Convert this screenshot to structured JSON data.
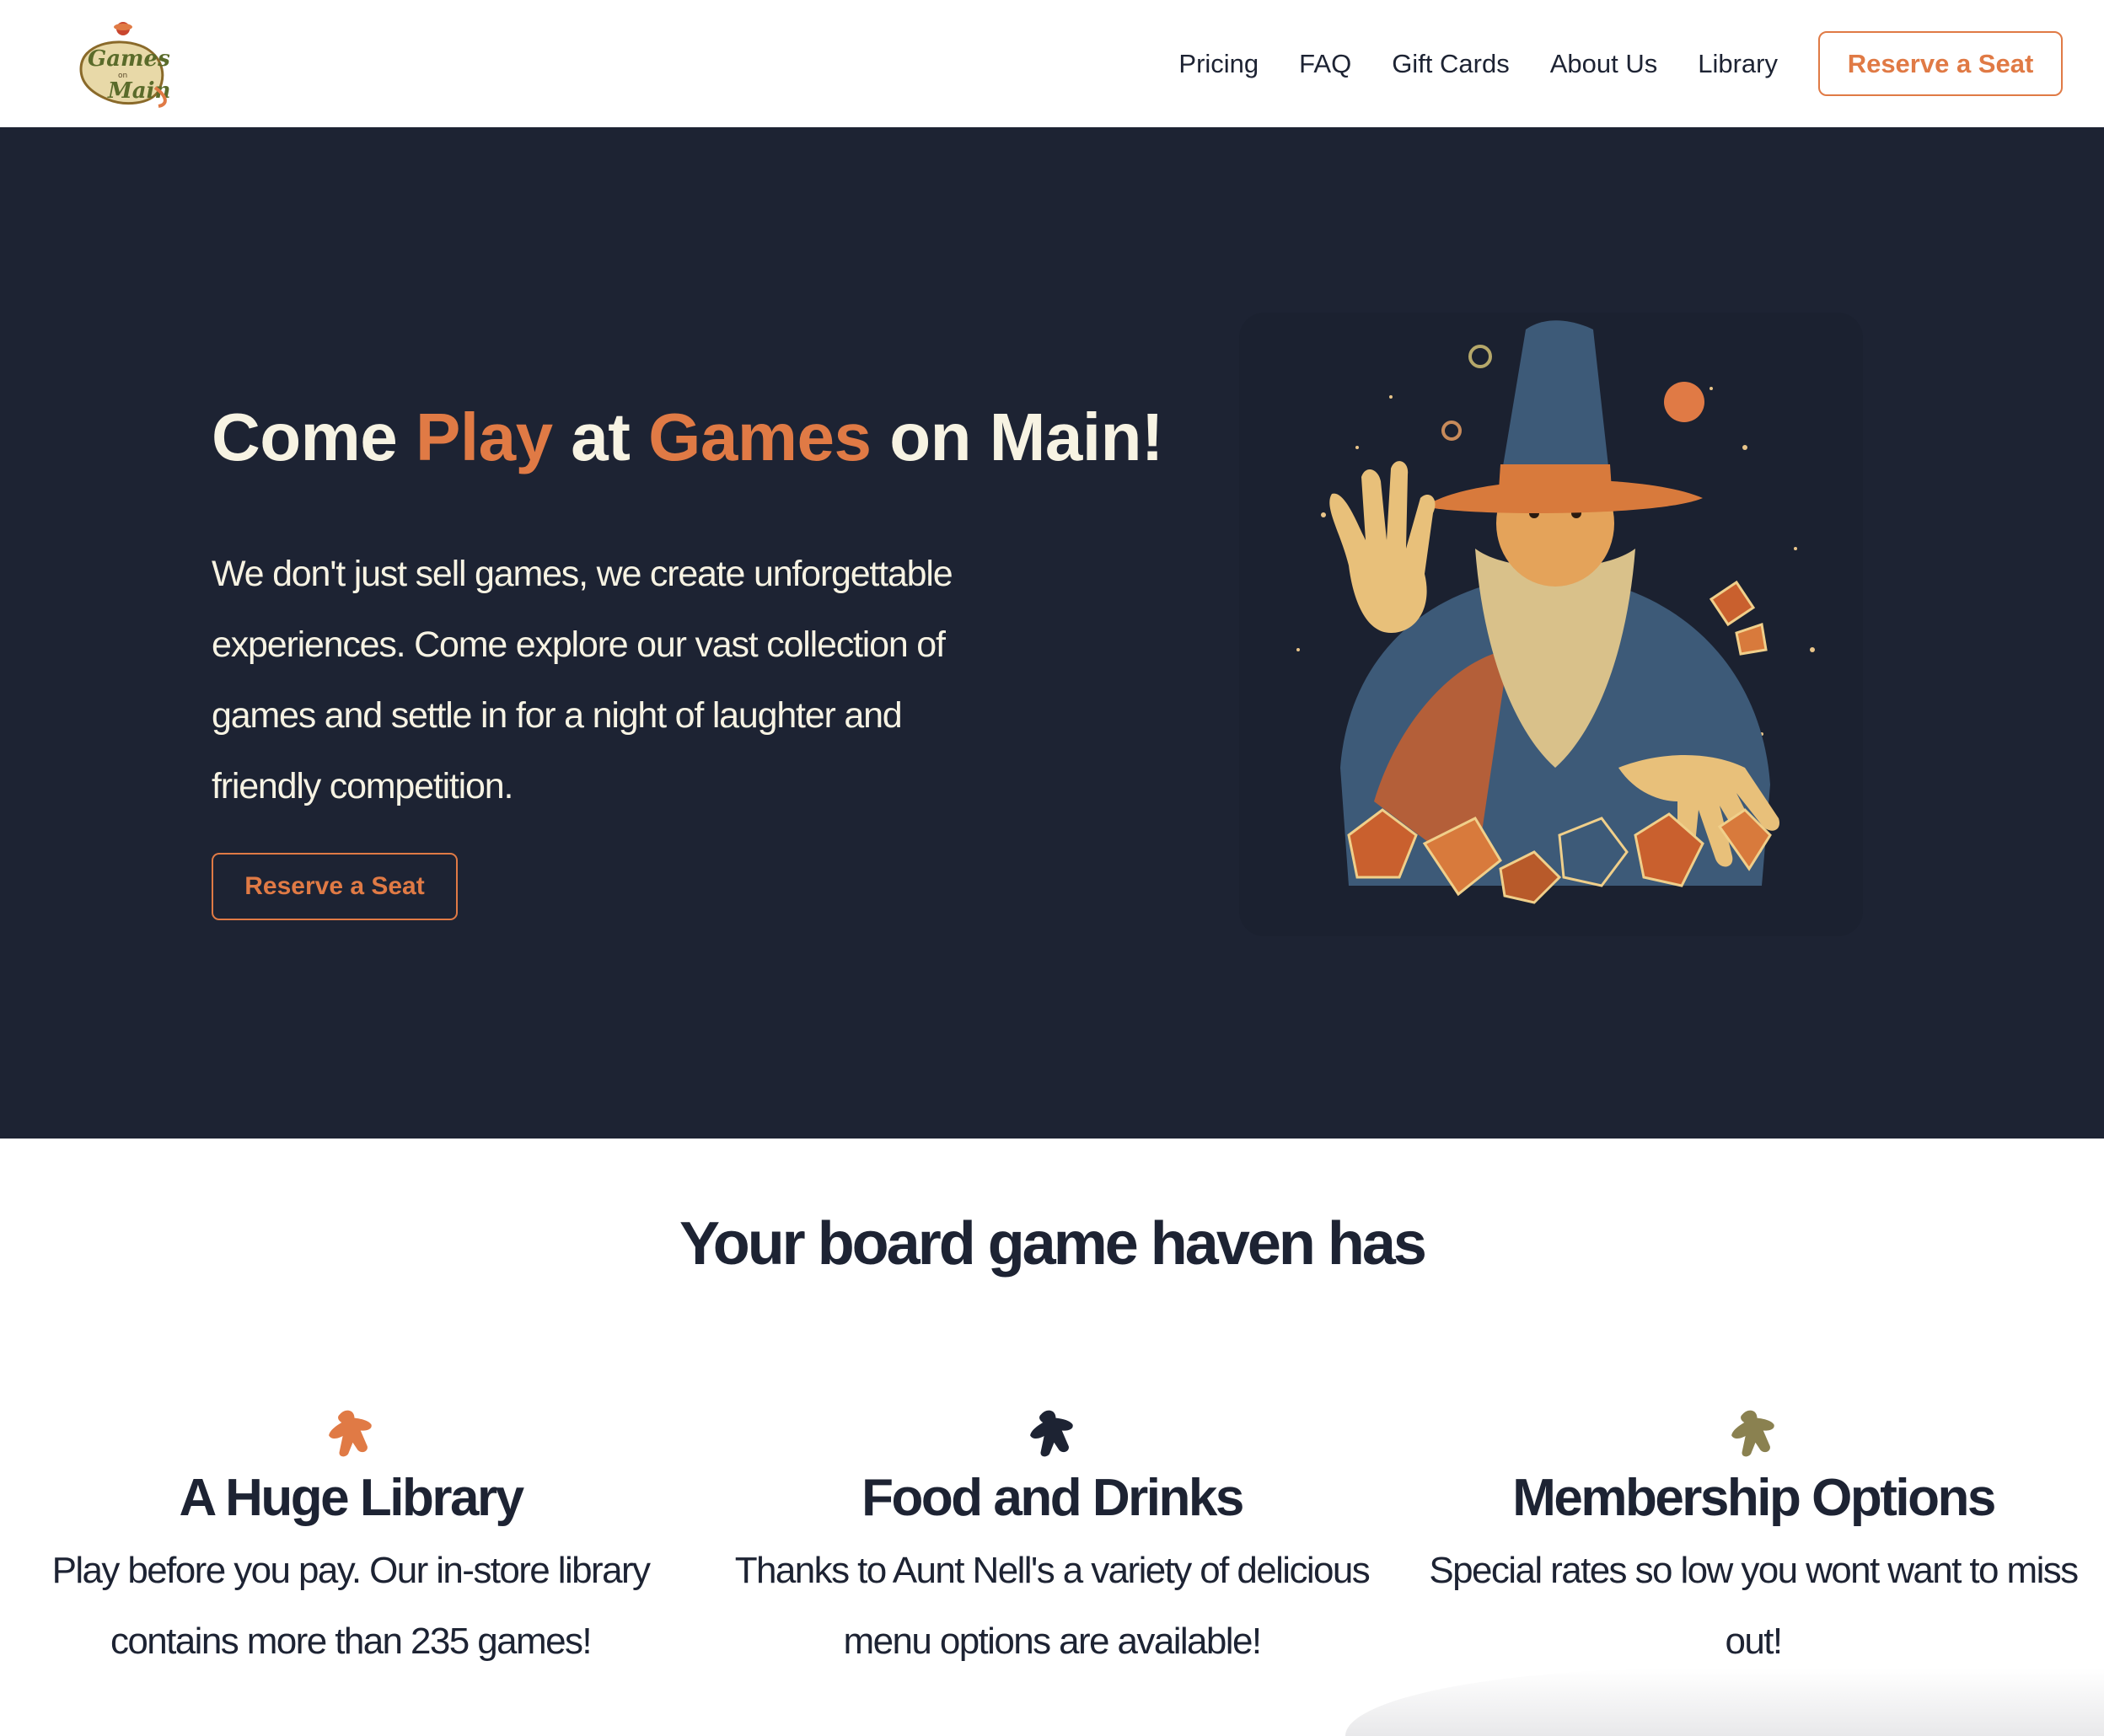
{
  "brand": {
    "logo_icon": "games-on-main-logo",
    "logo_text_top": "Games",
    "logo_text_mid": "on",
    "logo_text_bottom": "Main"
  },
  "nav": {
    "links": [
      "Pricing",
      "FAQ",
      "Gift Cards",
      "About Us",
      "Library"
    ],
    "cta": "Reserve a Seat"
  },
  "hero": {
    "title_part1": "Come ",
    "title_accent1": "Play",
    "title_part2": " at ",
    "title_accent2": "Games",
    "title_part3": " on Main!",
    "text": "We don't just sell games, we create unforgettable experiences. Come explore our vast collection of games and settle in for a night of laughter and friendly competition.",
    "cta": "Reserve a Seat",
    "image_icon": "wizard-with-dice-illustration"
  },
  "features": {
    "heading": "Your board game haven has",
    "items": [
      {
        "icon": "meeple-icon",
        "color": "#e07a45",
        "title": "A Huge Library",
        "text": "Play before you pay. Our in-store library contains more than 235 games!"
      },
      {
        "icon": "meeple-icon",
        "color": "#1d2333",
        "title": "Food and Drinks",
        "text": "Thanks to Aunt Nell's a variety of delicious menu options are available!"
      },
      {
        "icon": "meeple-icon",
        "color": "#8a8150",
        "title": "Membership Options",
        "text": "Special rates so low you wont want to miss out!"
      }
    ]
  },
  "colors": {
    "accent": "#e07a45",
    "hero_bg": "#1d2333",
    "hero_text": "#f7f3e3",
    "olive": "#8a8150"
  }
}
